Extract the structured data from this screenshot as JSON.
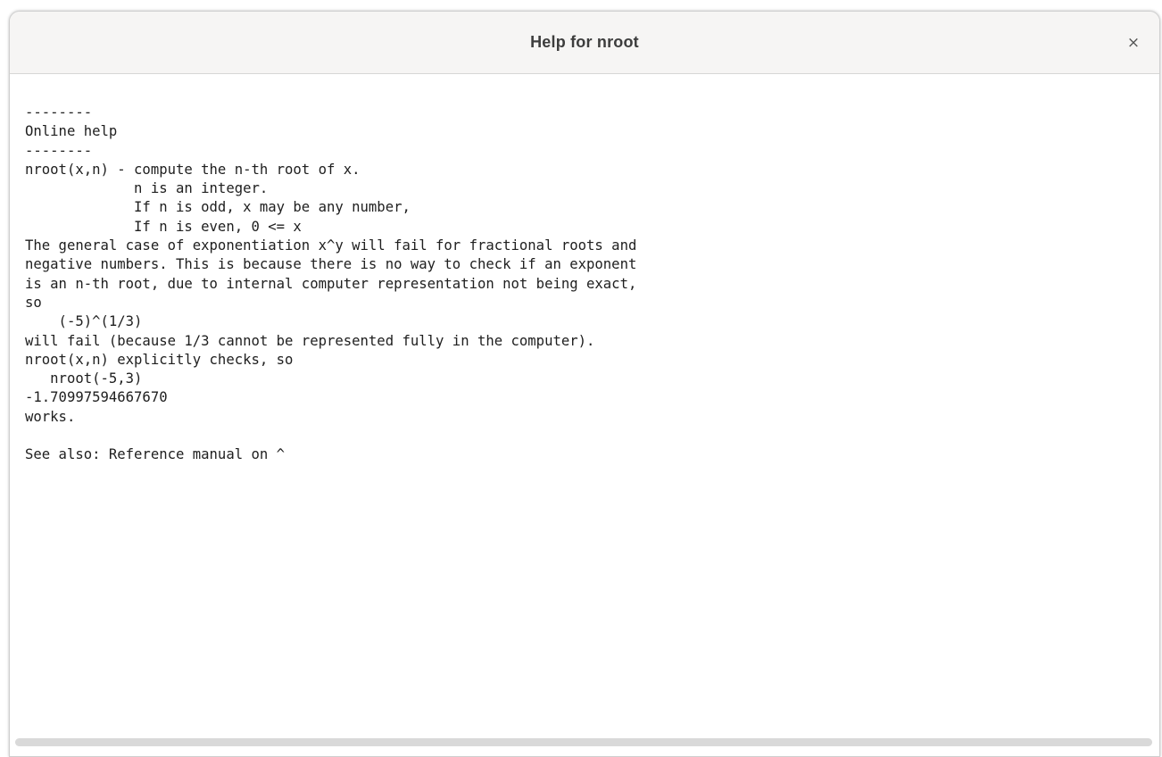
{
  "window": {
    "title": "Help for nroot",
    "close_icon": "close-icon",
    "close_glyph": "×"
  },
  "help": {
    "lines": [
      "--------",
      "Online help",
      "--------",
      "nroot(x,n) - compute the n-th root of x.",
      "             n is an integer.",
      "             If n is odd, x may be any number,",
      "             If n is even, 0 <= x",
      "The general case of exponentiation x^y will fail for fractional roots and",
      "negative numbers. This is because there is no way to check if an exponent",
      "is an n-th root, due to internal computer representation not being exact,",
      "so",
      "    (-5)^(1/3)",
      "will fail (because 1/3 cannot be represented fully in the computer).",
      "nroot(x,n) explicitly checks, so",
      "   nroot(-5,3)",
      "-1.70997594667670",
      "works.",
      "",
      "See also: Reference manual on ^"
    ]
  },
  "scrollbar": {
    "horizontal_position": 0,
    "horizontal_visible_fraction": 1.0
  },
  "colors": {
    "titlebar_bg": "#f6f5f4",
    "content_bg": "#ffffff",
    "text": "#202020"
  }
}
